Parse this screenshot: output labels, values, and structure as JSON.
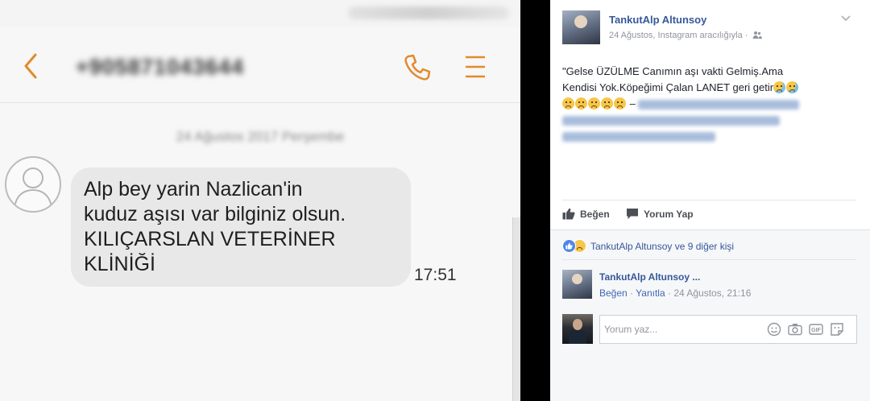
{
  "sms": {
    "phone_number": "+905871043644",
    "date_separator": "24 Ağustos 2017 Perşembe",
    "message_lines": [
      "Alp bey yarin Nazlican'in",
      "kuduz aşısı var bilginiz olsun.",
      "KILIÇARSLAN VETERİNER",
      "KLİNİĞİ"
    ],
    "time": "17:51",
    "accent_color": "#e38a2c"
  },
  "facebook": {
    "author": "TankutAlp Altunsoy",
    "meta": "24 Ağustos, Instagram aracılığıyla ·",
    "post_lines": [
      "\"Gelse ÜZÜLME Canımın aşı vakti Gelmiş.Ama",
      "Kendisi Yok.Köpeğimi Çalan LANET geri getir",
      "–"
    ],
    "actions": {
      "like": "Beğen",
      "comment": "Yorum Yap"
    },
    "reactions_text": "TankutAlp Altunsoy ve 9 diğer kişi",
    "comment": {
      "author": "TankutAlp Altunsoy ...",
      "like": "Beğen",
      "reply": "Yanıtla",
      "time": "24 Ağustos, 21:16"
    },
    "write_placeholder": "Yorum yaz...",
    "link_color": "#365899",
    "icons": [
      "chevron-down-icon",
      "friends-icon",
      "like-icon",
      "comment-icon",
      "smile-icon",
      "camera-icon",
      "gif-icon",
      "sticker-icon"
    ]
  }
}
